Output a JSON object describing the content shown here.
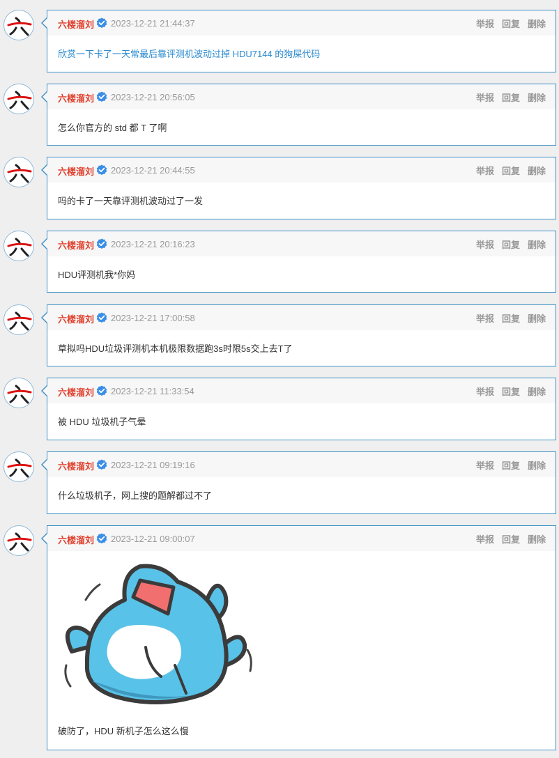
{
  "comments": [
    {
      "author": "六楼溜刘",
      "time": "2023-12-21 21:44:37",
      "text": "欣赏一下卡了一天常最后靠评测机波动过掉 HDU7144 的狗屎代码",
      "actions": [
        "举报",
        "回复",
        "删除"
      ]
    },
    {
      "author": "六楼溜刘",
      "time": "2023-12-21 20:56:05",
      "text": "怎么你官方的 std 都 T 了啊",
      "actions": [
        "举报",
        "回复",
        "删除"
      ]
    },
    {
      "author": "六楼溜刘",
      "time": "2023-12-21 20:44:55",
      "text": "吗的卡了一天靠评测机波动过了一发",
      "actions": [
        "举报",
        "回复",
        "删除"
      ]
    },
    {
      "author": "六楼溜刘",
      "time": "2023-12-21 20:16:23",
      "text": "HDU评测机我*你妈",
      "actions": [
        "举报",
        "回复",
        "删除"
      ]
    },
    {
      "author": "六楼溜刘",
      "time": "2023-12-21 17:00:58",
      "text": "草拟吗HDU垃圾评测机本机极限数据跑3s时限5s交上去T了",
      "actions": [
        "举报",
        "回复",
        "删除"
      ]
    },
    {
      "author": "六楼溜刘",
      "time": "2023-12-21 11:33:54",
      "text": "被 HDU 垃圾机子气晕",
      "actions": [
        "举报",
        "回复",
        "删除"
      ]
    },
    {
      "author": "六楼溜刘",
      "time": "2023-12-21 09:19:16",
      "text": "什么垃圾机子，网上搜的题解都过不了",
      "actions": [
        "举报",
        "回复",
        "删除"
      ]
    },
    {
      "author": "六楼溜刘",
      "time": "2023-12-21 09:00:07",
      "text": "破防了，HDU 新机子怎么这么慢",
      "actions": [
        "举报",
        "回复",
        "删除"
      ]
    }
  ],
  "colors": {
    "author": "#e0412e",
    "link": "#2a8ad0",
    "card_border": "#3d8fc6",
    "verified": "#3a8ee6",
    "page_bg": "#efefef"
  },
  "icons": {
    "verified": "verified-badge-icon",
    "avatar": "avatar-glyph-六"
  }
}
